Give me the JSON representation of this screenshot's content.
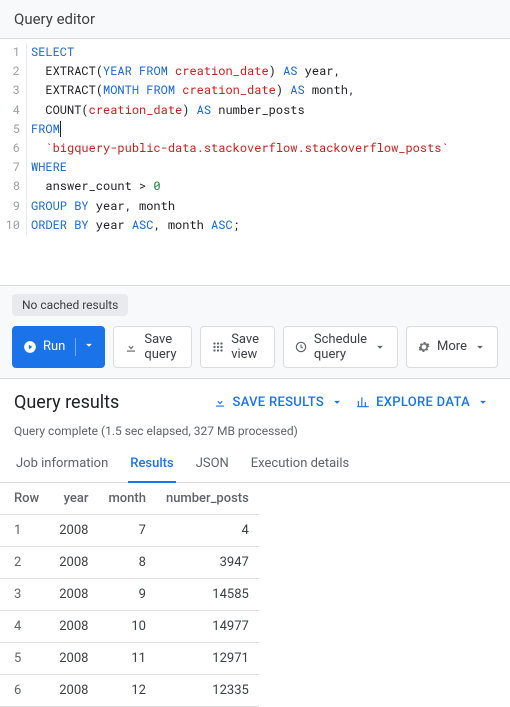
{
  "header": {
    "title": "Query editor"
  },
  "sql": {
    "lines": [
      [
        [
          "kw",
          "SELECT"
        ]
      ],
      [
        [
          "plain",
          "  "
        ],
        [
          "fn",
          "EXTRACT"
        ],
        [
          "plain",
          "("
        ],
        [
          "kw",
          "YEAR FROM"
        ],
        [
          "plain",
          " "
        ],
        [
          "col",
          "creation_date"
        ],
        [
          "plain",
          ") "
        ],
        [
          "as",
          "AS"
        ],
        [
          "plain",
          " year,"
        ]
      ],
      [
        [
          "plain",
          "  "
        ],
        [
          "fn",
          "EXTRACT"
        ],
        [
          "plain",
          "("
        ],
        [
          "kw",
          "MONTH FROM"
        ],
        [
          "plain",
          " "
        ],
        [
          "col",
          "creation_date"
        ],
        [
          "plain",
          ") "
        ],
        [
          "as",
          "AS"
        ],
        [
          "plain",
          " month,"
        ]
      ],
      [
        [
          "plain",
          "  "
        ],
        [
          "fn",
          "COUNT"
        ],
        [
          "plain",
          "("
        ],
        [
          "col",
          "creation_date"
        ],
        [
          "plain",
          ") "
        ],
        [
          "as",
          "AS"
        ],
        [
          "plain",
          " number_posts"
        ]
      ],
      [
        [
          "kw",
          "FROM"
        ]
      ],
      [
        [
          "plain",
          "  "
        ],
        [
          "str",
          "`bigquery-public-data.stackoverflow.stackoverflow_posts`"
        ]
      ],
      [
        [
          "kw",
          "WHERE"
        ]
      ],
      [
        [
          "plain",
          "  answer_count > "
        ],
        [
          "num",
          "0"
        ]
      ],
      [
        [
          "kw",
          "GROUP BY"
        ],
        [
          "plain",
          " year, month"
        ]
      ],
      [
        [
          "kw",
          "ORDER BY"
        ],
        [
          "plain",
          " year "
        ],
        [
          "kw",
          "ASC"
        ],
        [
          "plain",
          ", month "
        ],
        [
          "kw",
          "ASC"
        ],
        [
          "plain",
          ";"
        ]
      ]
    ]
  },
  "status": {
    "cache": "No cached results"
  },
  "toolbar": {
    "run": "Run",
    "save_query": "Save query",
    "save_view": "Save view",
    "schedule": "Schedule query",
    "more": "More"
  },
  "results": {
    "title": "Query results",
    "save_results": "SAVE RESULTS",
    "explore_data": "EXPLORE DATA",
    "meta": "Query complete (1.5 sec elapsed, 327 MB processed)",
    "tabs": {
      "job": "Job information",
      "results": "Results",
      "json": "JSON",
      "exec": "Execution details"
    },
    "columns": [
      "Row",
      "year",
      "month",
      "number_posts"
    ],
    "rows": [
      [
        "1",
        "2008",
        "7",
        "4"
      ],
      [
        "2",
        "2008",
        "8",
        "3947"
      ],
      [
        "3",
        "2008",
        "9",
        "14585"
      ],
      [
        "4",
        "2008",
        "10",
        "14977"
      ],
      [
        "5",
        "2008",
        "11",
        "12971"
      ],
      [
        "6",
        "2008",
        "12",
        "12335"
      ]
    ]
  }
}
